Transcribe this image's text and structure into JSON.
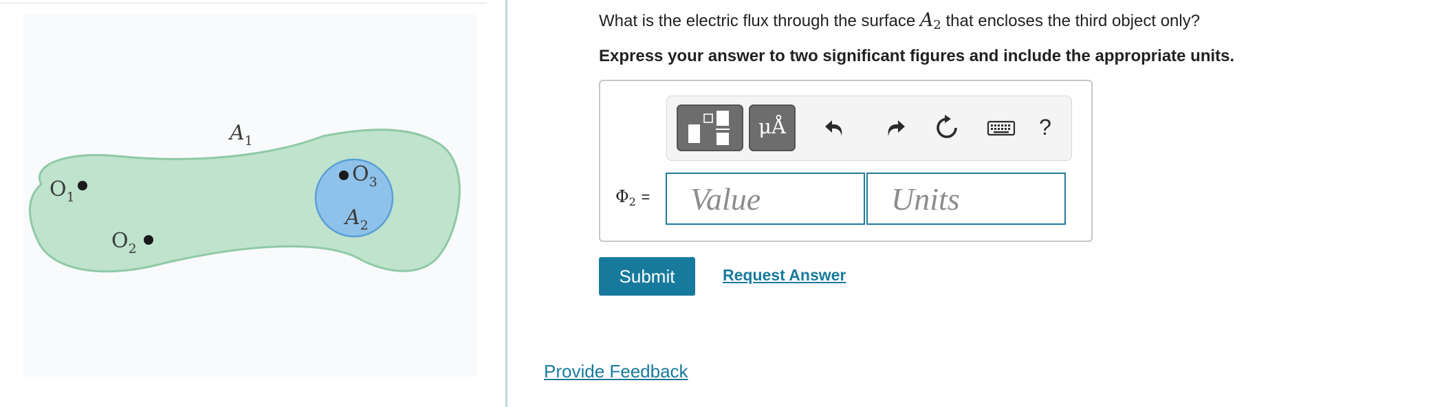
{
  "figure": {
    "surface_outer_label": "A",
    "surface_outer_subscript": "1",
    "surface_inner_label": "A",
    "surface_inner_subscript": "2",
    "objects": [
      {
        "letter": "O",
        "subscript": "1"
      },
      {
        "letter": "O",
        "subscript": "2"
      },
      {
        "letter": "O",
        "subscript": "3"
      }
    ],
    "colors": {
      "outer_fill": "#bfe3cc",
      "outer_stroke": "#8fc9a6",
      "inner_fill": "#8fc2ea",
      "inner_stroke": "#5a9fd6"
    }
  },
  "question": {
    "prefix": "What is the electric flux through the surface",
    "symbol": "A",
    "symbol_subscript": "2",
    "suffix": "that encloses the third object only?"
  },
  "instruction": "Express your answer to two significant figures and include the appropriate units.",
  "toolbar": {
    "units_label": "μÅ",
    "help_label": "?",
    "icons": [
      "templates-icon",
      "units-icon",
      "undo-icon",
      "redo-icon",
      "reset-icon",
      "keyboard-icon",
      "help-icon"
    ]
  },
  "answer": {
    "symbol": "Φ",
    "symbol_subscript": "2",
    "equals": "=",
    "value_placeholder": "Value",
    "units_placeholder": "Units"
  },
  "actions": {
    "submit_label": "Submit",
    "request_answer_label": "Request Answer"
  },
  "feedback_label": "Provide Feedback",
  "colors": {
    "accent": "#177a9c",
    "divider": "#c3d5e0"
  }
}
